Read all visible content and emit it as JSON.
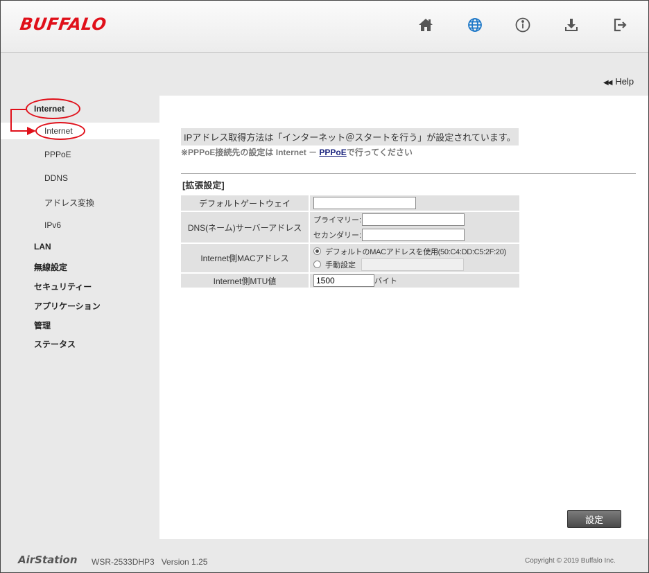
{
  "header": {
    "logo": "BUFFALO",
    "icons": [
      "home-icon",
      "globe-icon",
      "info-icon",
      "download-icon",
      "logout-icon"
    ]
  },
  "help": {
    "arrows": "◀◀",
    "label": "Help"
  },
  "nav": {
    "internet": "Internet",
    "sub": [
      "Internet",
      "PPPoE",
      "DDNS",
      "アドレス変換",
      "IPv6"
    ],
    "categories": [
      "LAN",
      "無線設定",
      "セキュリティー",
      "アプリケーション",
      "管理",
      "ステータス"
    ]
  },
  "content": {
    "notice": "IPアドレス取得方法は「インターネット＠スタートを行う」が設定されています。",
    "note_prefix": "※PPPoE接続先の設定は Internet － ",
    "note_link": "PPPoE",
    "note_suffix": "で行ってください",
    "section_title": "[拡張設定]",
    "rows": {
      "gateway_label": "デフォルトゲートウェイ",
      "gateway_value": "",
      "dns_label": "DNS(ネーム)サーバーアドレス",
      "dns_primary_label": "プライマリー:",
      "dns_primary_value": "",
      "dns_secondary_label": "セカンダリー:",
      "dns_secondary_value": "",
      "mac_label": "Internet側MACアドレス",
      "mac_default_option": "デフォルトのMACアドレスを使用(50:C4:DD:C5:2F:20)",
      "mac_manual_option": "手動設定",
      "mac_manual_value": "",
      "mtu_label": "Internet側MTU値",
      "mtu_value": "1500",
      "mtu_unit": "バイト"
    },
    "submit": "設定"
  },
  "footer": {
    "brand": "AirStation",
    "model": "WSR-2533DHP3   Version 1.25",
    "copyright": "Copyright © 2019 Buffalo Inc."
  },
  "colors": {
    "brand_red": "#e0101a",
    "globe_blue": "#1e78c8"
  }
}
